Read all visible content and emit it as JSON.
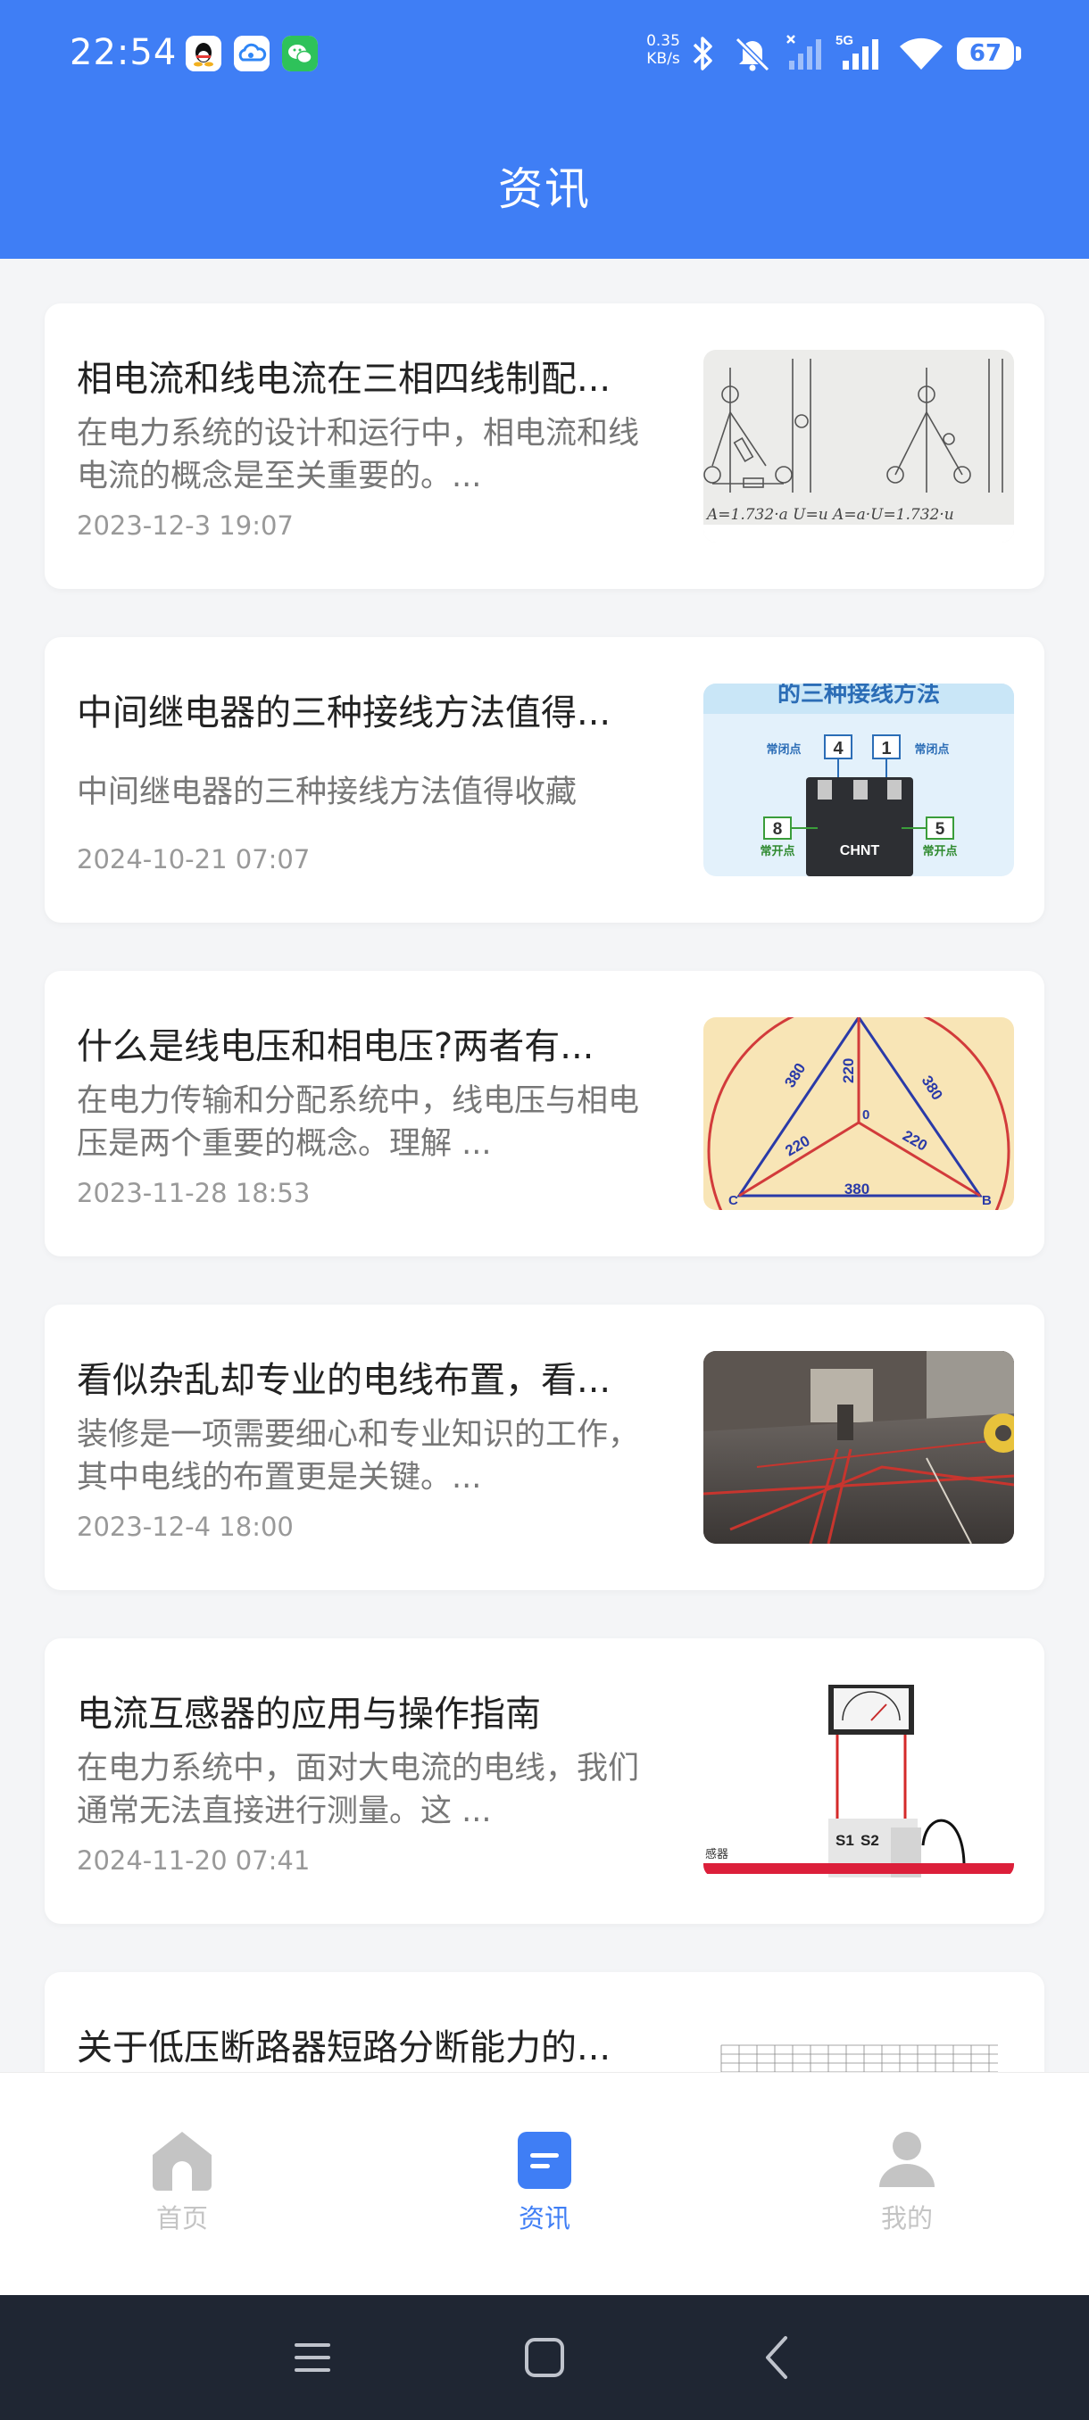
{
  "status_bar": {
    "time": "22:54",
    "net_speed_value": "0.35",
    "net_speed_unit": "KB/s",
    "network": "5G",
    "battery": "67",
    "app_icons": [
      "qq-icon",
      "cloud-icon",
      "wechat-icon"
    ]
  },
  "header": {
    "title": "资讯"
  },
  "articles": [
    {
      "title": "相电流和线电流在三相四线制配...",
      "summary": "在电力系统的设计和运行中，相电流和线电流的概念是至关重要的。...",
      "date": "2023-12-3 19:07",
      "thumb_handwritten": "A=1.732·a  U=u   A=a·U=1.732·u"
    },
    {
      "title": "中间继电器的三种接线方法值得...",
      "summary": "中间继电器的三种接线方法值得收藏",
      "date": "2024-10-21 07:07",
      "thumb_text": {
        "banner": "的三种接线方法",
        "nc": "常闭点",
        "no": "常开点",
        "n4": "4",
        "n1": "1",
        "n8": "8",
        "n5": "5",
        "brand": "CHNT"
      }
    },
    {
      "title": "什么是线电压和相电压?两者有...",
      "summary": "在电力传输和分配系统中，线电压与相电压是两个重要的概念。理解 ...",
      "date": "2023-11-28 18:53",
      "thumb_text": {
        "v380": "380",
        "v220": "220",
        "o": "0",
        "c": "C",
        "b": "B"
      }
    },
    {
      "title": "看似杂乱却专业的电线布置，看...",
      "summary": "装修是一项需要细心和专业知识的工作，其中电线的布置更是关键。...",
      "date": "2023-12-4 18:00"
    },
    {
      "title": "电流互感器的应用与操作指南",
      "summary": "在电力系统中，面对大电流的电线，我们通常无法直接进行测量。这 ...",
      "date": "2024-11-20 07:41",
      "thumb_text": {
        "s1": "S1",
        "s2": "S2",
        "label": "感器"
      }
    },
    {
      "title": "关于低压断路器短路分断能力的...",
      "summary": "",
      "date": ""
    }
  ],
  "tabbar": {
    "home": "首页",
    "news": "资讯",
    "mine": "我的",
    "active_color": "#3f7ef5",
    "inactive_color": "#c4c4c4"
  }
}
